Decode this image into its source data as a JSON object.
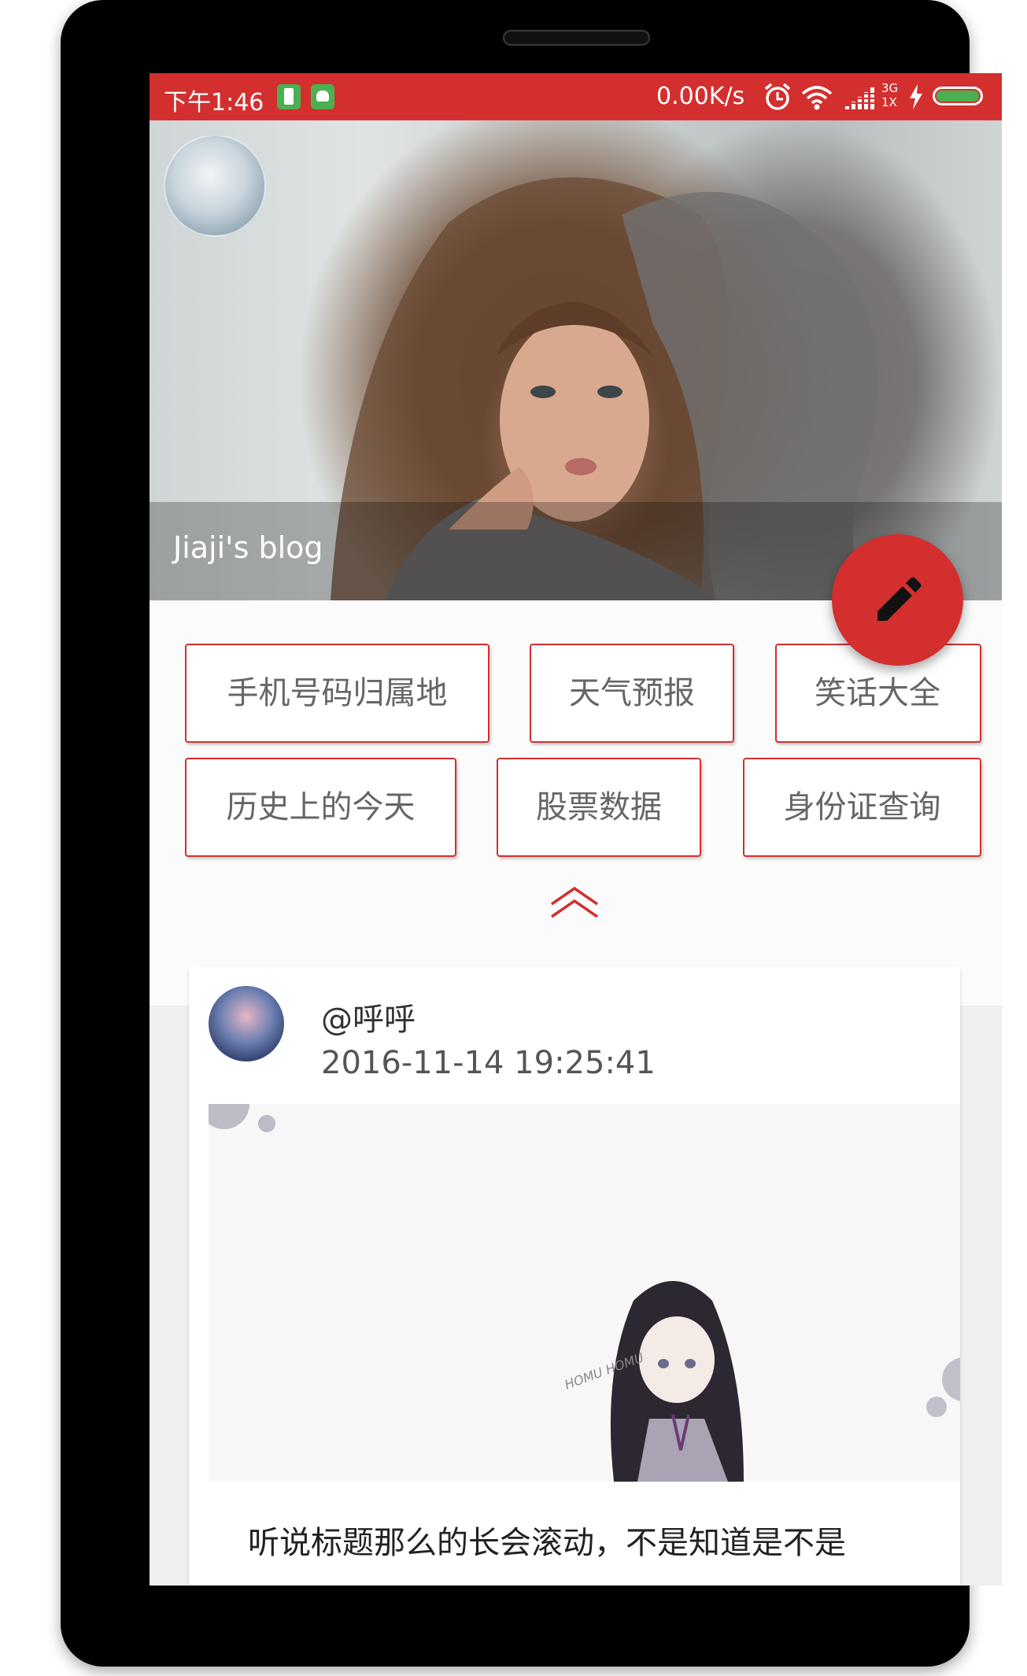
{
  "status_bar": {
    "time": "下午1:46",
    "speed": "0.00K/s",
    "network": "3G",
    "network_sub": "1X",
    "color": "#d32f2f"
  },
  "header": {
    "blog_title": "Jiaji's blog"
  },
  "fab": {
    "icon": "pencil-icon",
    "color": "#d32f2f"
  },
  "quick_buttons": [
    "手机号码归属地",
    "天气预报",
    "笑话大全",
    "历史上的今天",
    "股票数据",
    "身份证查询"
  ],
  "post": {
    "user": "@呼呼",
    "date": "2016-11-14 19:25:41",
    "image_caption": "HOMU HOMU",
    "text": "听说标题那么的长会滚动，不是知道是不是"
  },
  "accent_color": "#d32f2f"
}
